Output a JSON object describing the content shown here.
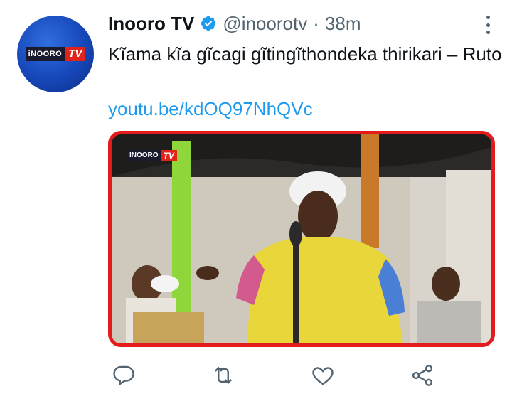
{
  "tweet": {
    "display_name": "Inooro TV",
    "handle": "@inoorotv",
    "separator": "·",
    "time": "38m",
    "text": "Kĩama kĩa gĩcagi gĩtingĩthondeka thirikari – Ruto",
    "link": "youtu.be/kdOQ97NhQVc"
  },
  "avatar": {
    "logo_part1": "iNOORO",
    "logo_part2": "TV"
  },
  "media": {
    "watermark_part1": "INOORO",
    "watermark_part2": "TV",
    "border_color": "#e31b1b"
  },
  "icons": {
    "verified": "verified-badge-icon",
    "more": "more-options-icon",
    "reply": "reply-icon",
    "retweet": "retweet-icon",
    "like": "like-icon",
    "share": "share-icon"
  },
  "colors": {
    "link": "#1d9bf0",
    "secondary_text": "#536471",
    "verified": "#1d9bf0"
  }
}
